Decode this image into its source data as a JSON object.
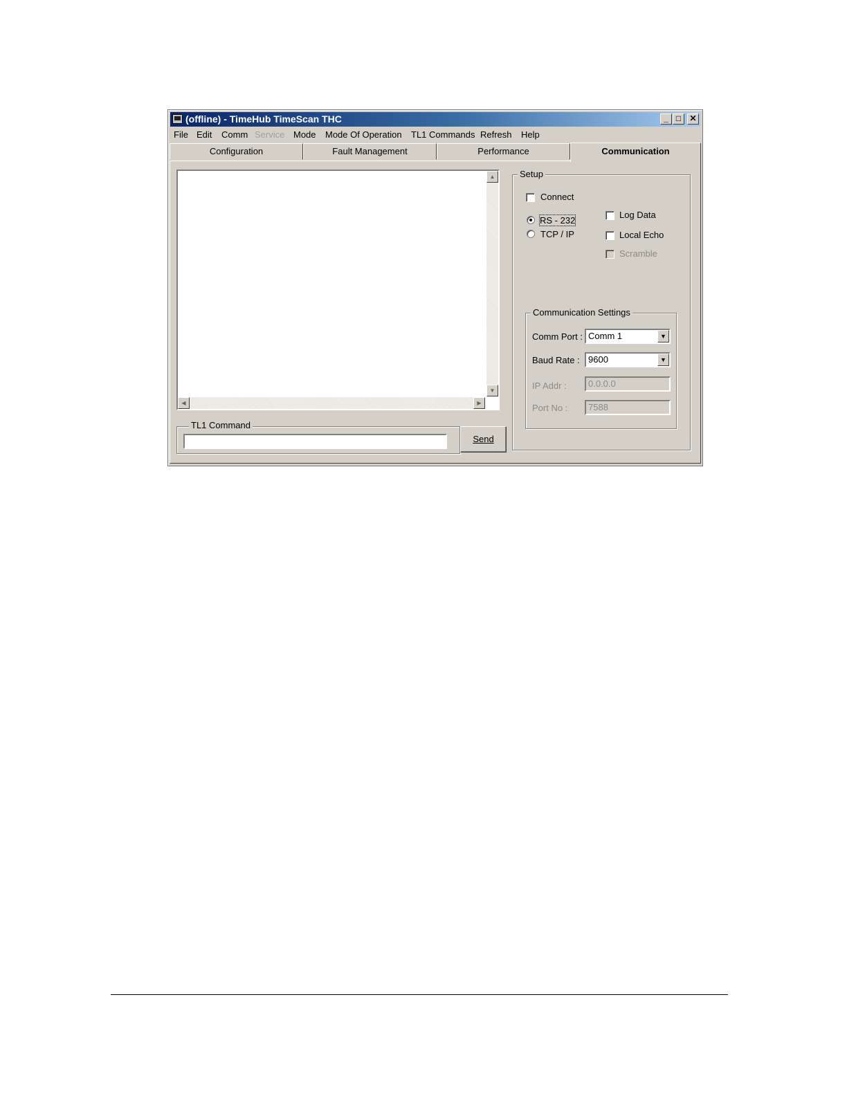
{
  "window": {
    "title": "(offline) - TimeHub TimeScan THC",
    "minimize": "_",
    "maximize": "□",
    "close": "✕"
  },
  "menu": [
    "File",
    "Edit",
    "Comm",
    "Service",
    "Mode",
    "Mode Of Operation",
    "TL1 Commands",
    "Refresh",
    "Help"
  ],
  "menu_disabled": [
    "Service"
  ],
  "tabs": [
    "Configuration",
    "Fault Management",
    "Performance",
    "Communication"
  ],
  "active_tab": "Communication",
  "output": {
    "content": ""
  },
  "tl1": {
    "group_label": "TL1 Command",
    "input_value": "",
    "send_label": "Send"
  },
  "setup": {
    "group_label": "Setup",
    "connect_label": "Connect",
    "connect_checked": false,
    "rs232_label": "RS - 232",
    "rs232_selected": true,
    "tcpip_label": "TCP / IP",
    "tcpip_selected": false,
    "log_data_label": "Log Data",
    "local_echo_label": "Local Echo",
    "scramble_label": "Scramble"
  },
  "comm_settings": {
    "group_label": "Communication Settings",
    "comm_port_label": "Comm Port :",
    "comm_port_value": "Comm 1",
    "baud_rate_label": "Baud Rate :",
    "baud_rate_value": "9600",
    "ip_addr_label": "IP Addr :",
    "ip_addr_value": "0.0.0.0",
    "port_no_label": "Port No :",
    "port_no_value": "7588"
  }
}
